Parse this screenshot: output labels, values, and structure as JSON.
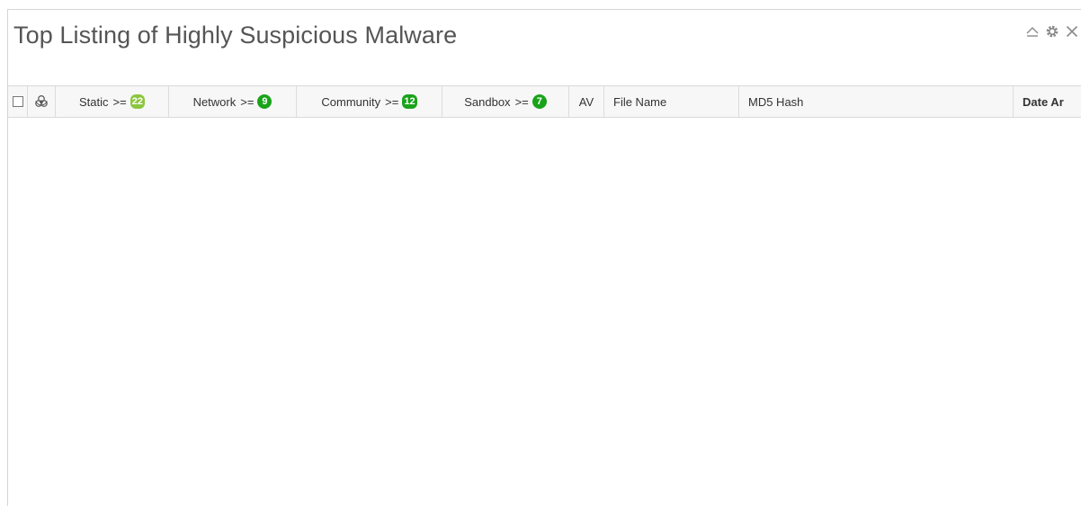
{
  "widget": {
    "title": "Top Listing of Highly Suspicious Malware",
    "controls": [
      "collapse-icon",
      "gear-icon",
      "close-icon"
    ]
  },
  "table": {
    "columns": {
      "select": "",
      "hazard": "biohazard-icon",
      "static": {
        "label": "Static",
        "op": ">=",
        "value": "22",
        "color": "#8cc63f"
      },
      "network": {
        "label": "Network",
        "op": ">=",
        "value": "9",
        "color": "#1aa31a"
      },
      "community": {
        "label": "Community",
        "op": ">=",
        "value": "12",
        "color": "#1aa31a"
      },
      "sandbox": {
        "label": "Sandbox",
        "op": ">=",
        "value": "7",
        "color": "#1aa31a"
      },
      "av": "AV",
      "file_name": "File Name",
      "md5": "MD5 Hash",
      "date": "Date Ar"
    },
    "rows": []
  }
}
